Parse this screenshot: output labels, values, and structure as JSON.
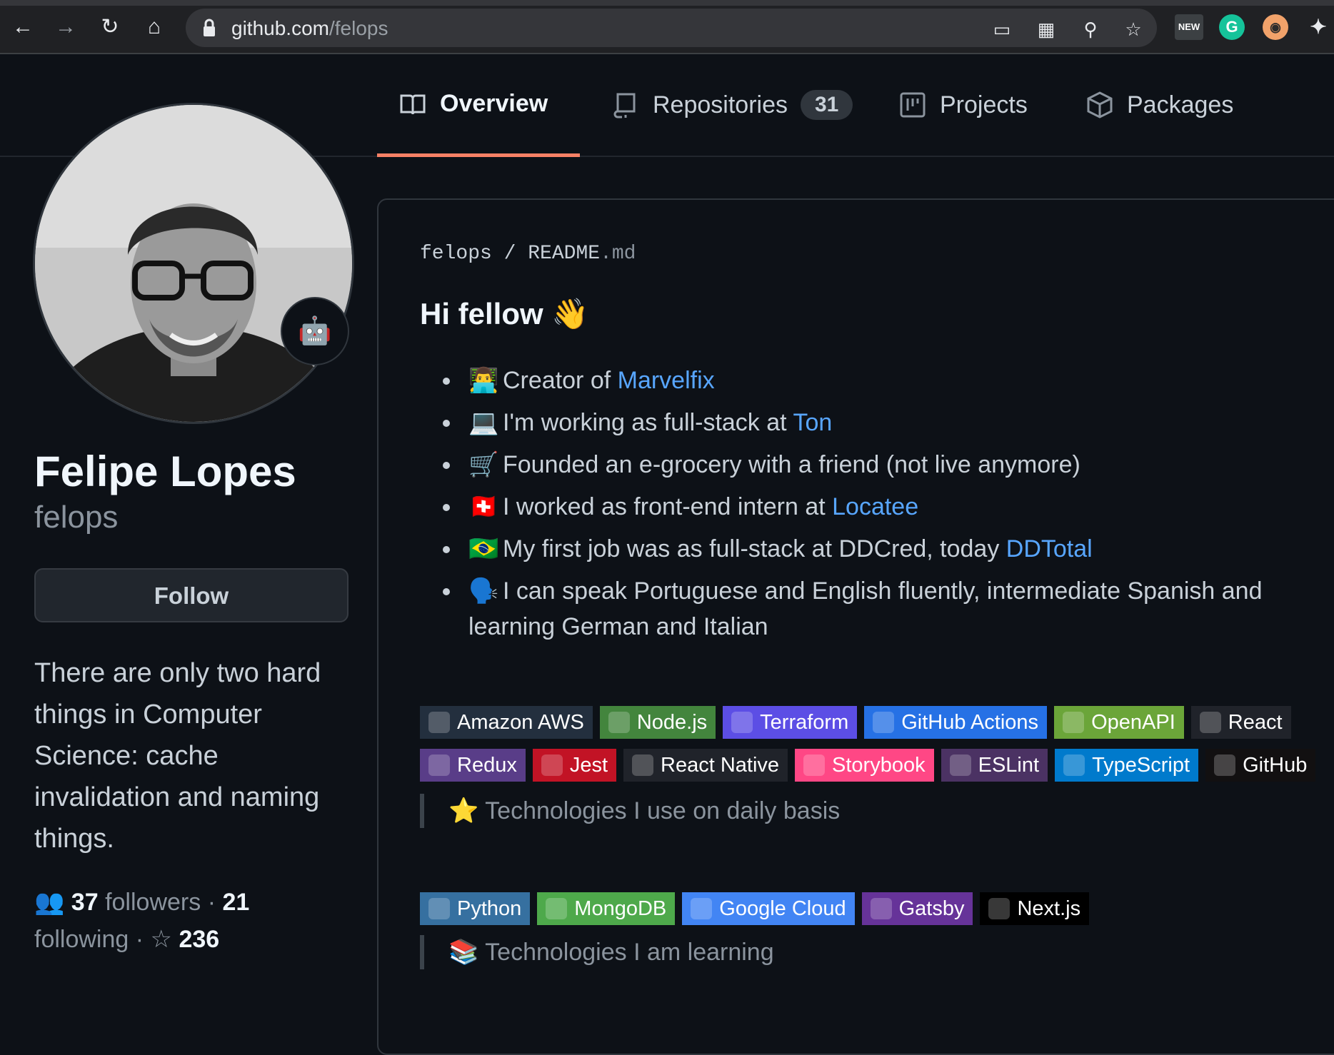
{
  "browser": {
    "url_host": "github.com",
    "url_path": "/felops"
  },
  "tabs": [
    {
      "label": "Overview"
    },
    {
      "label": "Repositories",
      "counter": "31"
    },
    {
      "label": "Projects"
    },
    {
      "label": "Packages"
    }
  ],
  "profile": {
    "name": "Felipe Lopes",
    "login": "felops",
    "follow_label": "Follow",
    "bio": "There are only two hard things in Computer Science: cache invalidation and naming things.",
    "followers_count": "37",
    "followers_label": "followers",
    "following_count": "21",
    "following_label": "following",
    "stars_count": "236"
  },
  "readme": {
    "owner": "felops",
    "file_base": "README",
    "file_ext": ".md",
    "greeting": "Hi fellow 👋",
    "bullets": [
      {
        "emoji": "👨‍💻",
        "text": "Creator of ",
        "link": "Marvelfix"
      },
      {
        "emoji": "💻",
        "text": "I'm working as full-stack at ",
        "link": "Ton"
      },
      {
        "emoji": "🛒",
        "text": "Founded an e-grocery with a friend (not live anymore)",
        "link": ""
      },
      {
        "emoji": "🇨🇭",
        "text": "I worked as front-end intern at ",
        "link": "Locatee"
      },
      {
        "emoji": "🇧🇷",
        "text": "My first job was as full-stack at DDCred, today ",
        "link": "DDTotal"
      },
      {
        "emoji": "🗣️",
        "text": "I can speak Portuguese and English fluently, intermediate Spanish and learning German and Italian",
        "link": ""
      }
    ],
    "daily_badges": [
      {
        "label": "Amazon AWS",
        "color": "#232f3e",
        "icon": "aws"
      },
      {
        "label": "Node.js",
        "color": "#43853d",
        "icon": "node"
      },
      {
        "label": "Terraform",
        "color": "#5c4ee5",
        "icon": "terraform"
      },
      {
        "label": "GitHub Actions",
        "color": "#2671e5",
        "icon": "gha"
      },
      {
        "label": "OpenAPI",
        "color": "#6ba539",
        "icon": "openapi"
      },
      {
        "label": "React",
        "color": "#20232a",
        "icon": "react"
      },
      {
        "label": "Redux",
        "color": "#593d88",
        "icon": "redux"
      },
      {
        "label": "Jest",
        "color": "#c21325",
        "icon": "jest"
      },
      {
        "label": "React Native",
        "color": "#20232a",
        "icon": "react"
      },
      {
        "label": "Storybook",
        "color": "#ff4785",
        "icon": "storybook"
      },
      {
        "label": "ESLint",
        "color": "#4b3263",
        "icon": "eslint"
      },
      {
        "label": "TypeScript",
        "color": "#007acc",
        "icon": "ts"
      },
      {
        "label": "GitHub",
        "color": "#121011",
        "icon": "github"
      }
    ],
    "daily_caption": "⭐ Technologies I use on daily basis",
    "learning_badges": [
      {
        "label": "Python",
        "color": "#3670a0",
        "icon": "python"
      },
      {
        "label": "MongoDB",
        "color": "#4ea94b",
        "icon": "mongodb"
      },
      {
        "label": "Google Cloud",
        "color": "#4285f4",
        "icon": "gcloud"
      },
      {
        "label": "Gatsby",
        "color": "#663399",
        "icon": "gatsby"
      },
      {
        "label": "Next.js",
        "color": "#000000",
        "icon": "nextjs"
      }
    ],
    "learning_caption": "📚 Technologies I am learning"
  }
}
